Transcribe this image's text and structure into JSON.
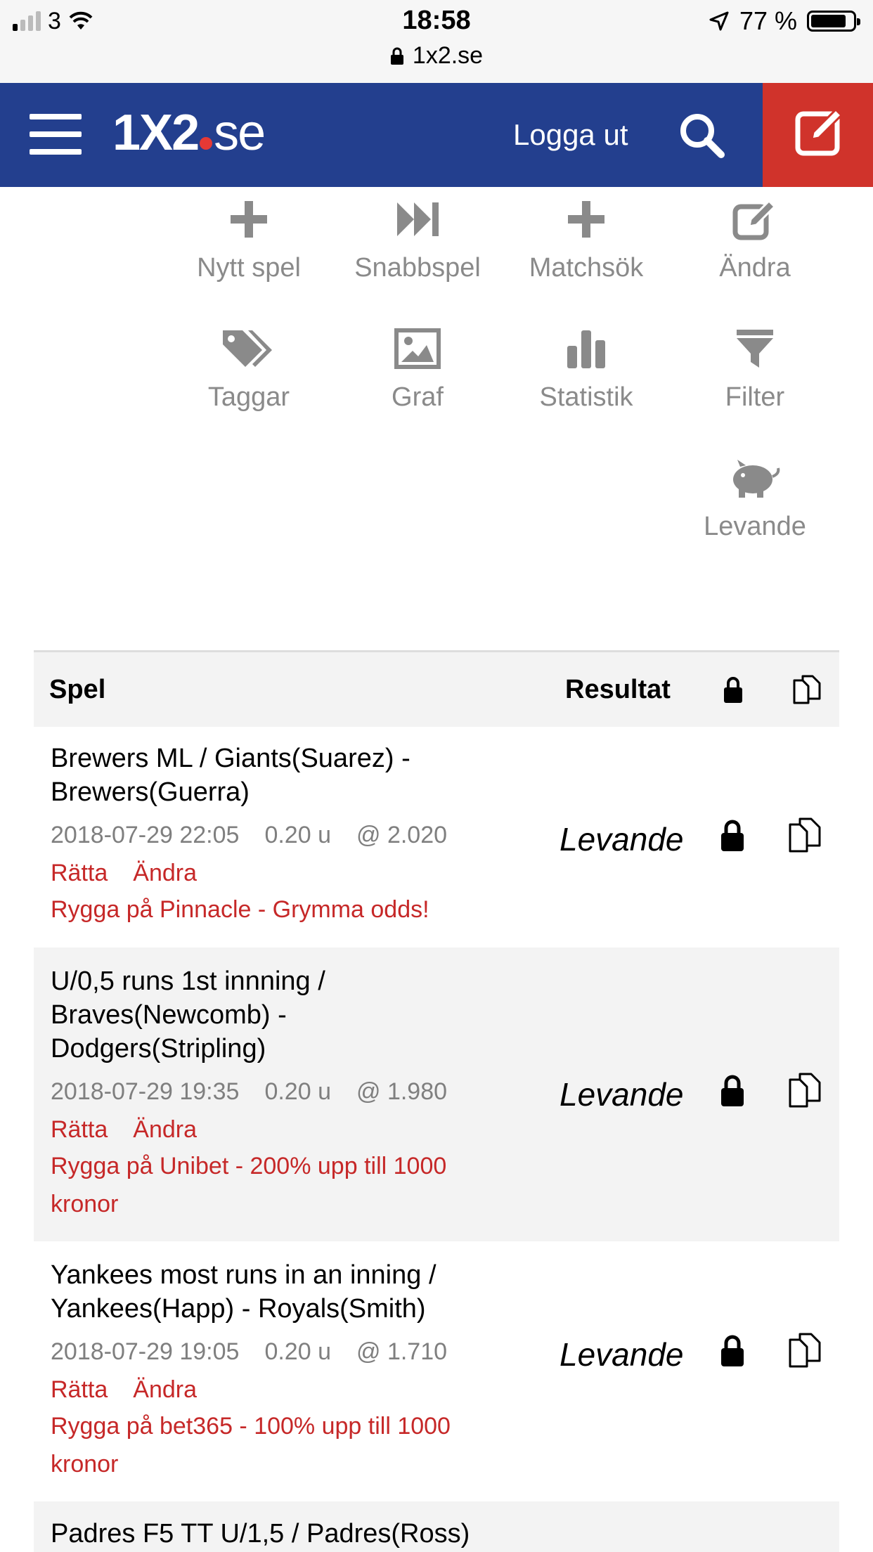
{
  "status_bar": {
    "carrier": "3",
    "time": "18:58",
    "url": "1x2.se",
    "battery": "77 %"
  },
  "nav": {
    "logo_main": "1X2",
    "logo_tld": "se",
    "logout": "Logga ut"
  },
  "menu": [
    {
      "label": "Nytt spel",
      "icon": "plus-icon"
    },
    {
      "label": "Snabbspel",
      "icon": "fast-forward-icon"
    },
    {
      "label": "Matchsök",
      "icon": "plus-icon"
    },
    {
      "label": "Ändra",
      "icon": "edit-icon"
    },
    {
      "label": "Taggar",
      "icon": "tags-icon"
    },
    {
      "label": "Graf",
      "icon": "image-icon"
    },
    {
      "label": "Statistik",
      "icon": "bar-chart-icon"
    },
    {
      "label": "Filter",
      "icon": "filter-icon"
    },
    {
      "label": "Levande",
      "icon": "piggy-bank-icon"
    }
  ],
  "table": {
    "headers": {
      "game": "Spel",
      "result": "Resultat"
    },
    "rows": [
      {
        "game": "Brewers ML / Giants(Suarez) - Brewers(Guerra)",
        "date": "2018-07-29 22:05",
        "units": "0.20 u",
        "odds": "@ 2.020",
        "link_correct": "Rätta",
        "link_edit": "Ändra",
        "promo": "Rygga på Pinnacle - Grymma odds!",
        "result": "Levande"
      },
      {
        "game": "U/0,5 runs 1st innning / Braves(Newcomb) - Dodgers(Stripling)",
        "date": "2018-07-29 19:35",
        "units": "0.20 u",
        "odds": "@ 1.980",
        "link_correct": "Rätta",
        "link_edit": "Ändra",
        "promo": "Rygga på Unibet - 200% upp till 1000 kronor",
        "result": "Levande"
      },
      {
        "game": "Yankees most runs in an inning / Yankees(Happ) - Royals(Smith)",
        "date": "2018-07-29 19:05",
        "units": "0.20 u",
        "odds": "@ 1.710",
        "link_correct": "Rätta",
        "link_edit": "Ändra",
        "promo": "Rygga på bet365 - 100% upp till 1000 kronor",
        "result": "Levande"
      },
      {
        "game": "Padres F5 TT U/1,5 / Padres(Ross)"
      }
    ]
  },
  "colors": {
    "nav": "#233f8e",
    "edit_button": "#d0332b",
    "link_red": "#c62828",
    "muted": "#8a8a8a"
  }
}
